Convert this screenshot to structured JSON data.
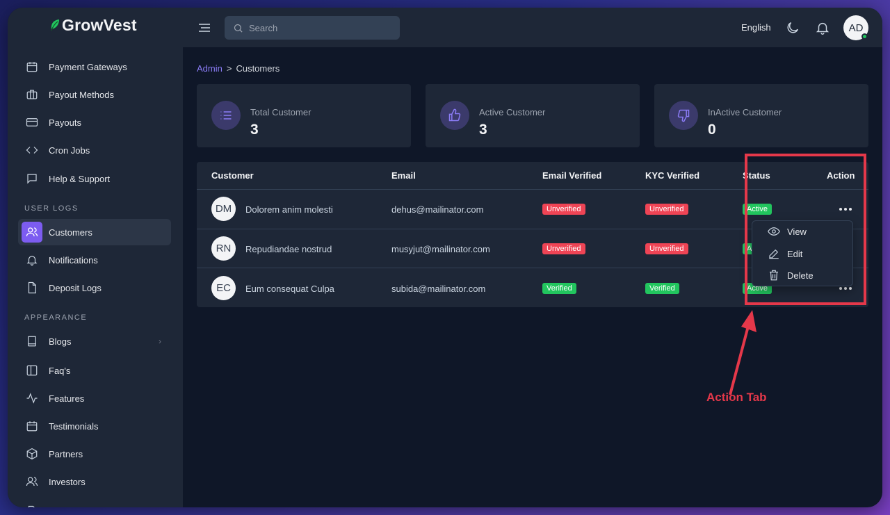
{
  "brand": {
    "name": "GrowVest"
  },
  "topbar": {
    "search_placeholder": "Search",
    "language": "English",
    "avatar_initials": "AD"
  },
  "sidebar": {
    "items_top": [
      {
        "label": "Payment Gateways",
        "icon": "calendar-icon"
      },
      {
        "label": "Payout Methods",
        "icon": "briefcase-icon"
      },
      {
        "label": "Payouts",
        "icon": "card-icon"
      },
      {
        "label": "Cron Jobs",
        "icon": "code-icon"
      },
      {
        "label": "Help & Support",
        "icon": "chat-icon"
      }
    ],
    "section_user_logs": "USER LOGS",
    "items_user_logs": [
      {
        "label": "Customers",
        "icon": "users-icon",
        "active": true
      },
      {
        "label": "Notifications",
        "icon": "bell-icon"
      },
      {
        "label": "Deposit Logs",
        "icon": "file-icon"
      }
    ],
    "section_appearance": "APPEARANCE",
    "items_appearance": [
      {
        "label": "Blogs",
        "icon": "book-icon"
      },
      {
        "label": "Faq's",
        "icon": "columns-icon"
      },
      {
        "label": "Features",
        "icon": "activity-icon"
      },
      {
        "label": "Testimonials",
        "icon": "calendar-icon"
      },
      {
        "label": "Partners",
        "icon": "box-icon"
      },
      {
        "label": "Investors",
        "icon": "users-icon"
      }
    ]
  },
  "breadcrumb": {
    "root": "Admin",
    "separator": ">",
    "current": "Customers"
  },
  "stats": [
    {
      "label": "Total Customer",
      "value": "3",
      "icon": "list-icon"
    },
    {
      "label": "Active Customer",
      "value": "3",
      "icon": "thumbs-up-icon"
    },
    {
      "label": "InActive Customer",
      "value": "0",
      "icon": "thumbs-down-icon"
    }
  ],
  "table": {
    "headers": [
      "Customer",
      "Email",
      "Email Verified",
      "KYC Verified",
      "Status",
      "Action"
    ],
    "rows": [
      {
        "initials": "DM",
        "name": "Dolorem anim molesti",
        "email": "dehus@mailinator.com",
        "email_verified": "Unverified",
        "kyc_verified": "Unverified",
        "status": "Active"
      },
      {
        "initials": "RN",
        "name": "Repudiandae nostrud",
        "email": "musyjut@mailinator.com",
        "email_verified": "Unverified",
        "kyc_verified": "Unverified",
        "status": "Active"
      },
      {
        "initials": "EC",
        "name": "Eum consequat Culpa",
        "email": "subida@mailinator.com",
        "email_verified": "Verified",
        "kyc_verified": "Verified",
        "status": "Active"
      }
    ]
  },
  "action_menu": {
    "items": [
      "View",
      "Edit",
      "Delete"
    ]
  },
  "annotation": {
    "label": "Action Tab"
  },
  "colors": {
    "accent": "#7c5cf0",
    "danger": "#ef4455",
    "success": "#22c55e",
    "annotation": "#e5384a"
  }
}
